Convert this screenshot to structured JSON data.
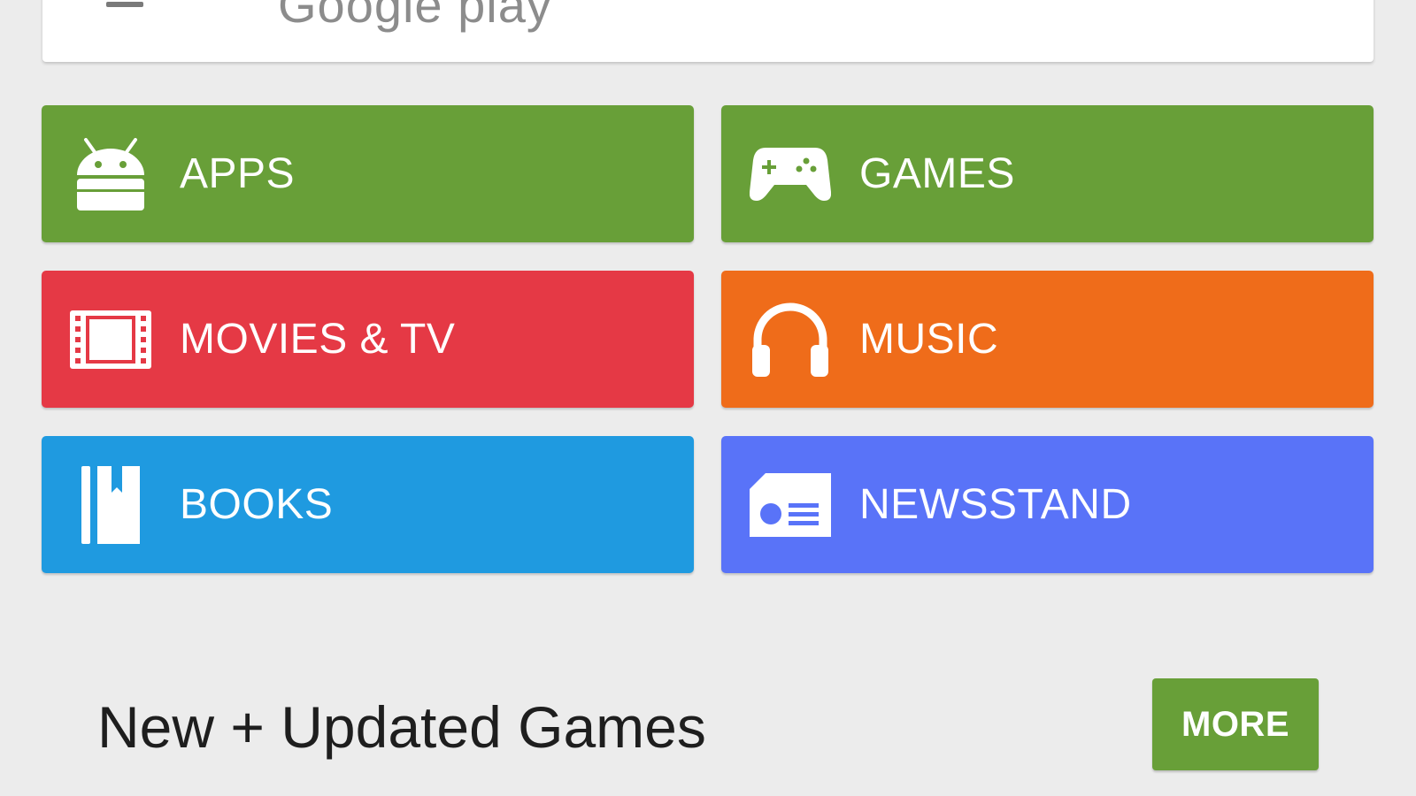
{
  "header": {
    "logo_text": "Google play",
    "menu_icon": "hamburger-menu-icon",
    "mic_icon": "microphone-icon"
  },
  "categories": [
    {
      "label": "APPS",
      "icon": "android-icon",
      "color": "#689f38"
    },
    {
      "label": "GAMES",
      "icon": "gamepad-icon",
      "color": "#689f38"
    },
    {
      "label": "MOVIES & TV",
      "icon": "film-icon",
      "color": "#e53945"
    },
    {
      "label": "MUSIC",
      "icon": "headphones-icon",
      "color": "#ef6c1a"
    },
    {
      "label": "BOOKS",
      "icon": "book-icon",
      "color": "#1f9ae0"
    },
    {
      "label": "NEWSSTAND",
      "icon": "newspaper-icon",
      "color": "#5973f8"
    }
  ],
  "section": {
    "title": "New + Updated Games",
    "more_label": "MORE",
    "more_color": "#689f38"
  }
}
